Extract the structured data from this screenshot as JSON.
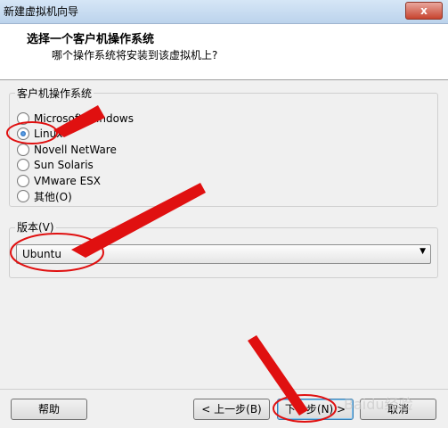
{
  "window": {
    "title": "新建虚拟机向导",
    "close_label": "x"
  },
  "header": {
    "title": "选择一个客户机操作系统",
    "subtitle": "哪个操作系统将安装到该虚拟机上?"
  },
  "os_group": {
    "legend": "客户机操作系统",
    "options": [
      {
        "label": "Microsoft Windows",
        "checked": false
      },
      {
        "label": "Linux",
        "checked": true
      },
      {
        "label": "Novell NetWare",
        "checked": false
      },
      {
        "label": "Sun Solaris",
        "checked": false
      },
      {
        "label": "VMware ESX",
        "checked": false
      },
      {
        "label": "其他(O)",
        "checked": false
      }
    ]
  },
  "version_group": {
    "legend": "版本(V)",
    "selected": "Ubuntu"
  },
  "buttons": {
    "help": "帮助",
    "back": "< 上一步(B)",
    "next": "下一步(N) >",
    "cancel": "取消"
  },
  "annotation_color": "#e01010",
  "watermark": "Baidu经验"
}
